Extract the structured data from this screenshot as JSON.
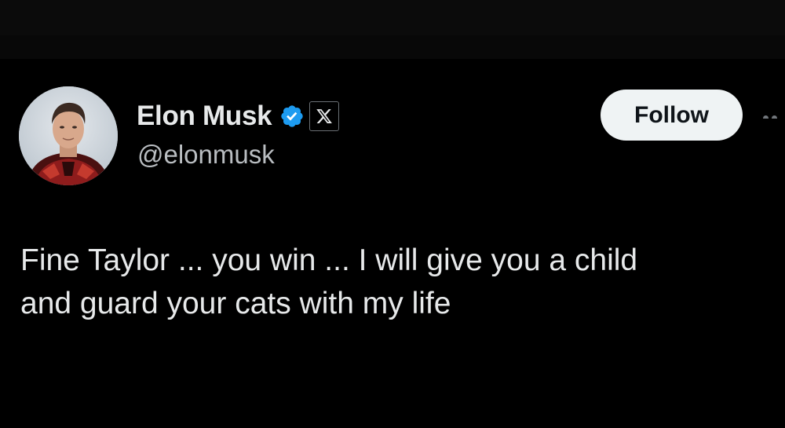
{
  "tweet": {
    "author": {
      "display_name": "Elon Musk",
      "handle": "@elonmusk",
      "avatar_icon": "avatar-photo",
      "verified_icon": "verified-badge-icon",
      "affiliation_icon": "x-logo-icon"
    },
    "follow_label": "Follow",
    "more_icon": "more-options-icon",
    "text_lines": [
      "Fine Taylor ... you win ... I will give you a child",
      "and guard your cats with my life"
    ]
  },
  "colors": {
    "background": "#000000",
    "text_primary": "#e7e9ea",
    "text_secondary": "#b9bdc1",
    "verified_blue": "#1d9bf0",
    "follow_bg": "#eff3f4",
    "follow_text": "#0f1419"
  }
}
